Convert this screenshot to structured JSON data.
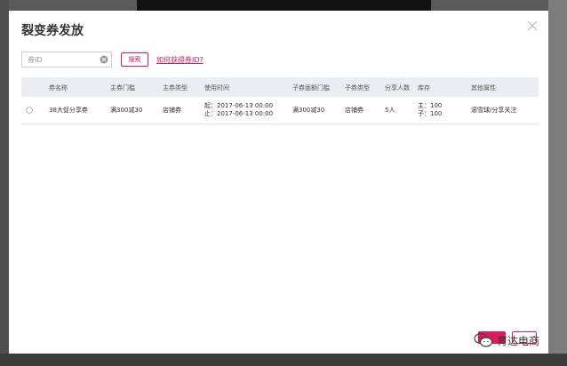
{
  "dialog": {
    "title": "裂变券发放",
    "close_icon": "close-icon"
  },
  "search": {
    "placeholder": "券ID",
    "button_label": "搜索",
    "help_link": "如何获得券ID?"
  },
  "table": {
    "headers": [
      "券名称",
      "主券门槛",
      "主券类型",
      "使用时间",
      "子券面额门槛",
      "子券类型",
      "分享人数",
      "库存",
      "其他属性"
    ],
    "rows": [
      {
        "name": "38大促分享券",
        "main_threshold": "满300减30",
        "main_type": "店铺券",
        "time_start": "起：2017-06-13 00:00",
        "time_end": "止：2017-06-13 00:00",
        "sub_threshold": "满300减30",
        "sub_type": "店铺券",
        "share_count": "5人",
        "stock_main": "主：100",
        "stock_sub": "子：100",
        "other": "滚雪球/分享关注"
      }
    ]
  },
  "colors": {
    "accent": "#e0195c",
    "header_bg": "#ebedf2"
  },
  "watermark": {
    "text": "育达电商",
    "icon": "wechat-icon"
  }
}
